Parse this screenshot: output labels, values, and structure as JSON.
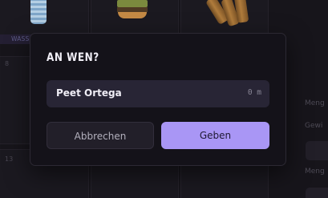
{
  "background": {
    "slot_label": "WASS",
    "slot_numbers": [
      "8",
      "13"
    ],
    "side_labels": [
      "Meng",
      "Gewi",
      "Meng"
    ]
  },
  "dialog": {
    "title": "AN WEN?",
    "recipient": {
      "name": "Peet Ortega",
      "distance": "0 m"
    },
    "cancel_label": "Abbrechen",
    "give_label": "Geben"
  },
  "colors": {
    "accent": "#a996f5",
    "dialog_bg": "#141219",
    "field_bg": "#282535",
    "page_bg": "#17151b"
  }
}
